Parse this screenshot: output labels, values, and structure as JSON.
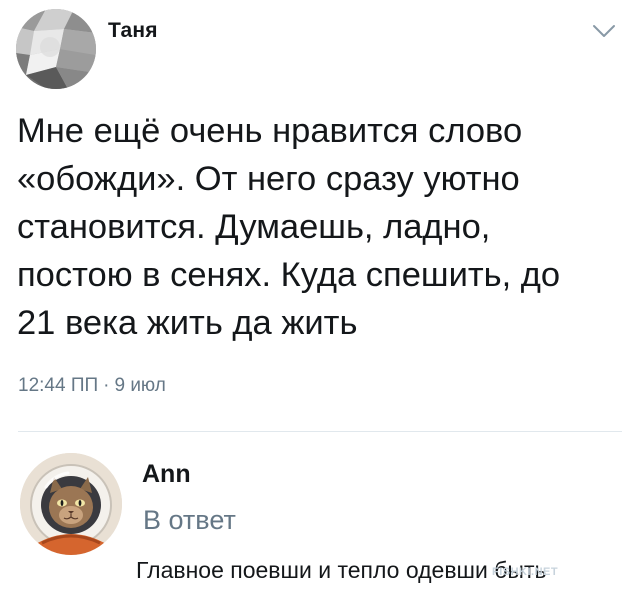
{
  "tweet": {
    "author_name": "Таня",
    "text_lines": [
      "Мне ещё очень нравится слово",
      "«обожди». От него сразу уютно",
      "становится. Думаешь, ладно,",
      "постою в сенях. Куда спешить, до",
      "21 века жить да жить"
    ],
    "time": "12:44 ПП",
    "separator": "·",
    "date": "9 июл"
  },
  "reply": {
    "author_name": "Ann",
    "label": "В ответ",
    "text": "Главное поевши и тепло одевши быть"
  },
  "watermark": "FISHKI.NET",
  "icons": {
    "menu": "chevron-down-icon",
    "tweet_avatar": "blurred-avatar-icon",
    "reply_avatar": "astronaut-cat-avatar-icon"
  },
  "colors": {
    "text": "#14171a",
    "secondary": "#657786",
    "divider": "#e1e8ed",
    "chevron": "#8899a6"
  }
}
